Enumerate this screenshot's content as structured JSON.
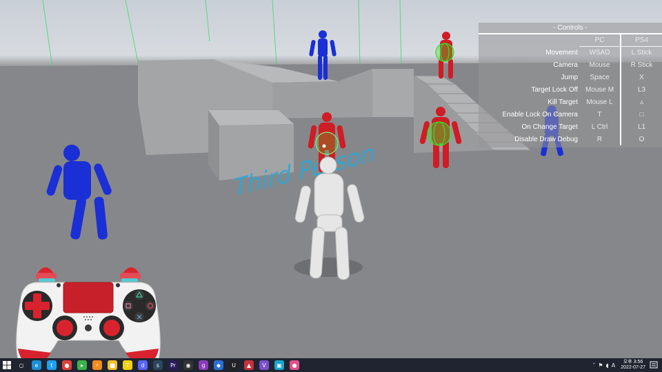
{
  "game": {
    "floor_text": "Third Person"
  },
  "controls": {
    "title": "- Controls -",
    "columns": [
      "PC",
      "PS4"
    ],
    "rows": [
      {
        "action": "Movement",
        "pc": "WSAD",
        "ps4": "L Stick"
      },
      {
        "action": "Camera",
        "pc": "Mouse",
        "ps4": "R Stick"
      },
      {
        "action": "Jump",
        "pc": "Space",
        "ps4": "X"
      },
      {
        "action": "Target Lock Off",
        "pc": "Mouse M",
        "ps4": "L3"
      },
      {
        "action": "Kill Target",
        "pc": "Mouse L",
        "ps4": "▵"
      },
      {
        "action": "Enable Lock On Camera",
        "pc": "T",
        "ps4": "□"
      },
      {
        "action": "On Change Target",
        "pc": "L Ctrl",
        "ps4": "L1"
      },
      {
        "action": "Disable Draw Debug",
        "pc": "R",
        "ps4": "O"
      }
    ]
  },
  "colors": {
    "enemy_blue": "#1a2fd6",
    "enemy_red": "#d01c24",
    "lock_sphere": "#36e02a",
    "player": "#e6e6e6",
    "debug_line": "#39d86b",
    "floor_text": "#2aa8d8",
    "controller_red": "#d8232e"
  },
  "controller": {
    "icons": [
      "dpad-icon",
      "touchpad-icon",
      "triangle-icon",
      "square-icon",
      "circle-icon",
      "cross-icon",
      "ps-logo-icon"
    ]
  },
  "taskbar": {
    "apps": [
      {
        "name": "search",
        "glyph": "○",
        "color": "#1f2430"
      },
      {
        "name": "edge",
        "glyph": "e",
        "color": "#1c8fd4"
      },
      {
        "name": "twitter",
        "glyph": "t",
        "color": "#1da1f2"
      },
      {
        "name": "chrome",
        "glyph": "●",
        "color": "#e0403a"
      },
      {
        "name": "app-green",
        "glyph": "▸",
        "color": "#3bb34a"
      },
      {
        "name": "search-tool",
        "glyph": "⌕",
        "color": "#f28c1a"
      },
      {
        "name": "explorer",
        "glyph": "■",
        "color": "#f2c12e"
      },
      {
        "name": "kakaotalk",
        "glyph": "T",
        "color": "#f5d10d"
      },
      {
        "name": "discord",
        "glyph": "d",
        "color": "#5865f2"
      },
      {
        "name": "steam",
        "glyph": "s",
        "color": "#2a475e"
      },
      {
        "name": "premiere",
        "glyph": "Pr",
        "color": "#2a1b5c"
      },
      {
        "name": "app-dark",
        "glyph": "◉",
        "color": "#333"
      },
      {
        "name": "github",
        "glyph": "g",
        "color": "#8a3ab9"
      },
      {
        "name": "app-blue",
        "glyph": "◆",
        "color": "#2d6fd2"
      },
      {
        "name": "unreal",
        "glyph": "U",
        "color": "#222"
      },
      {
        "name": "app-red",
        "glyph": "▲",
        "color": "#c8323c"
      },
      {
        "name": "visual-studio",
        "glyph": "V",
        "color": "#7b4fc9"
      },
      {
        "name": "app-cyan",
        "glyph": "▣",
        "color": "#1aa6c9"
      },
      {
        "name": "app-pink",
        "glyph": "●",
        "color": "#e0508a"
      }
    ],
    "time": "오후 3:56",
    "date": "2022-07-27",
    "tray": [
      "˄",
      "⚑",
      "◖",
      "A"
    ]
  }
}
